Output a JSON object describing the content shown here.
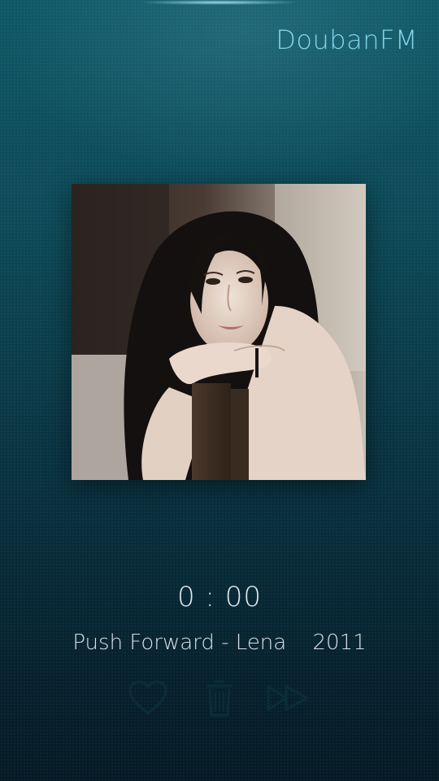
{
  "app": {
    "title": "DoubanFM"
  },
  "player": {
    "time": "0 : 00",
    "track_title": "Push Forward - Lena",
    "year": "2011",
    "cover_alt": "Album cover photo"
  },
  "controls": {
    "like_icon": "heart-icon",
    "trash_icon": "trash-icon",
    "next_icon": "fast-forward-icon"
  },
  "colors": {
    "accent": "#7fd4ea",
    "text": "#dfe8ec",
    "icon": "#0a2a35"
  }
}
